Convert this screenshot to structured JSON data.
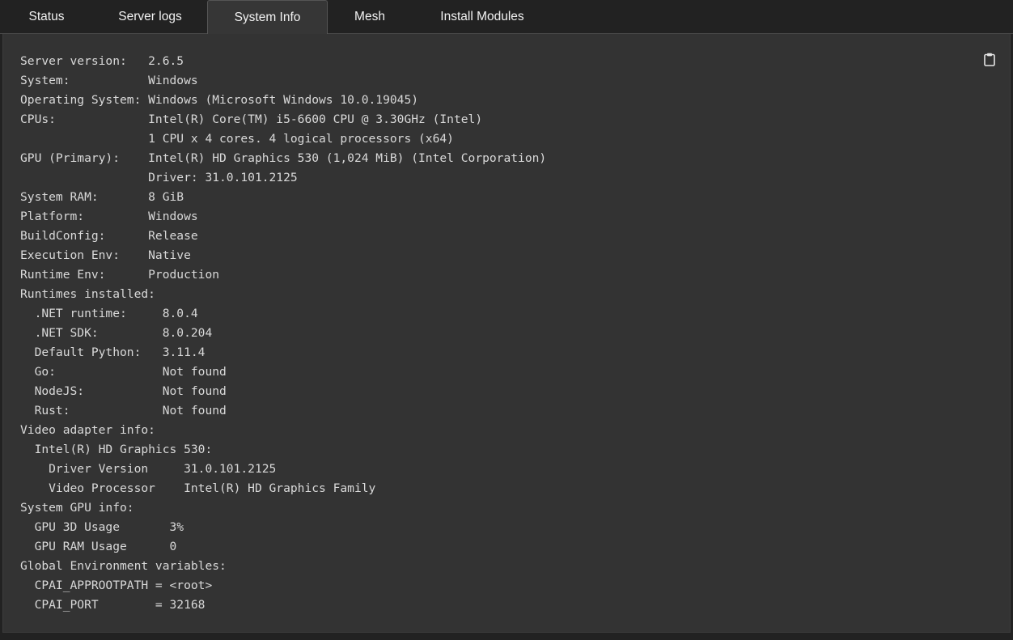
{
  "tabs": [
    {
      "label": "Status",
      "active": false
    },
    {
      "label": "Server logs",
      "active": false
    },
    {
      "label": "System Info",
      "active": true
    },
    {
      "label": "Mesh",
      "active": false
    },
    {
      "label": "Install Modules",
      "active": false
    }
  ],
  "panel": {
    "copy_icon": "clipboard-icon",
    "lines": [
      "Server version:   2.6.5",
      "System:           Windows",
      "Operating System: Windows (Microsoft Windows 10.0.19045)",
      "CPUs:             Intel(R) Core(TM) i5-6600 CPU @ 3.30GHz (Intel)",
      "                  1 CPU x 4 cores. 4 logical processors (x64)",
      "GPU (Primary):    Intel(R) HD Graphics 530 (1,024 MiB) (Intel Corporation)",
      "                  Driver: 31.0.101.2125",
      "System RAM:       8 GiB",
      "Platform:         Windows",
      "BuildConfig:      Release",
      "Execution Env:    Native",
      "Runtime Env:      Production",
      "Runtimes installed:",
      "  .NET runtime:     8.0.4",
      "  .NET SDK:         8.0.204",
      "  Default Python:   3.11.4",
      "  Go:               Not found",
      "  NodeJS:           Not found",
      "  Rust:             Not found",
      "Video adapter info:",
      "  Intel(R) HD Graphics 530:",
      "    Driver Version     31.0.101.2125",
      "    Video Processor    Intel(R) HD Graphics Family",
      "System GPU info:",
      "  GPU 3D Usage       3%",
      "  GPU RAM Usage      0",
      "Global Environment variables:",
      "  CPAI_APPROOTPATH = <root>",
      "  CPAI_PORT        = 32168"
    ]
  },
  "colors": {
    "page_background": "#222222",
    "panel_background": "#333333",
    "active_tab_background": "#363636",
    "text": "#d9d9d9",
    "tab_text": "#f2f2f2"
  }
}
